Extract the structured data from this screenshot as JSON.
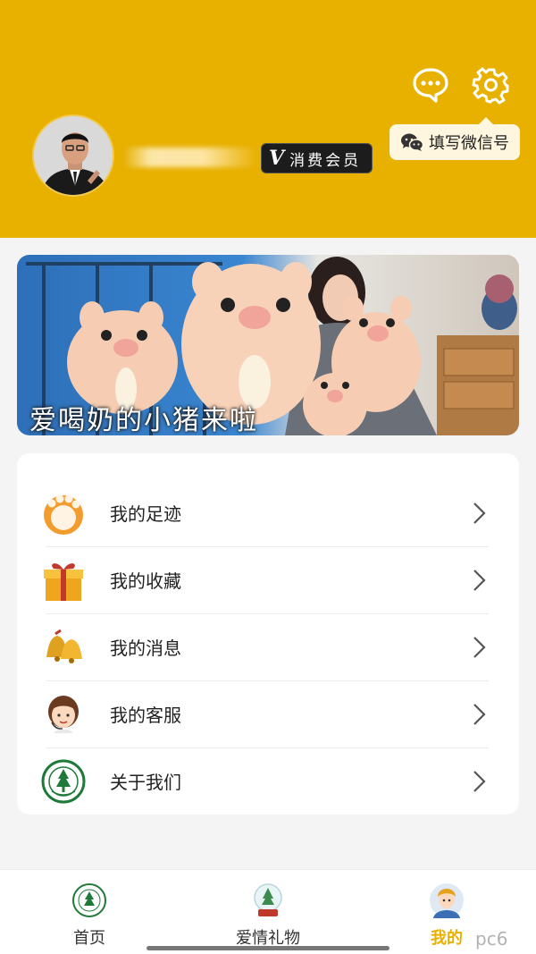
{
  "header": {
    "bg_color": "#e8b100",
    "chat_icon": "chat-bubble-icon",
    "settings_icon": "gear-icon",
    "vip_badge_mark": "V",
    "vip_badge_label": "消费会员",
    "wechat_button_label": "填写微信号",
    "wechat_icon": "wechat-icon"
  },
  "banner": {
    "caption": "爱喝奶的小猪来啦"
  },
  "menu": {
    "items": [
      {
        "label": "我的足迹",
        "icon": "paw-icon"
      },
      {
        "label": "我的收藏",
        "icon": "gift-box-icon"
      },
      {
        "label": "我的消息",
        "icon": "bell-icon"
      },
      {
        "label": "我的客服",
        "icon": "customer-service-icon"
      },
      {
        "label": "关于我们",
        "icon": "emblem-icon"
      }
    ]
  },
  "tabbar": {
    "tabs": [
      {
        "label": "首页",
        "icon": "home-emblem-icon",
        "active": false
      },
      {
        "label": "爱情礼物",
        "icon": "snow-globe-icon",
        "active": false
      },
      {
        "label": "我的",
        "icon": "profile-avatar-icon",
        "active": true
      }
    ],
    "active_color": "#e8b100"
  },
  "watermark": "pc6"
}
